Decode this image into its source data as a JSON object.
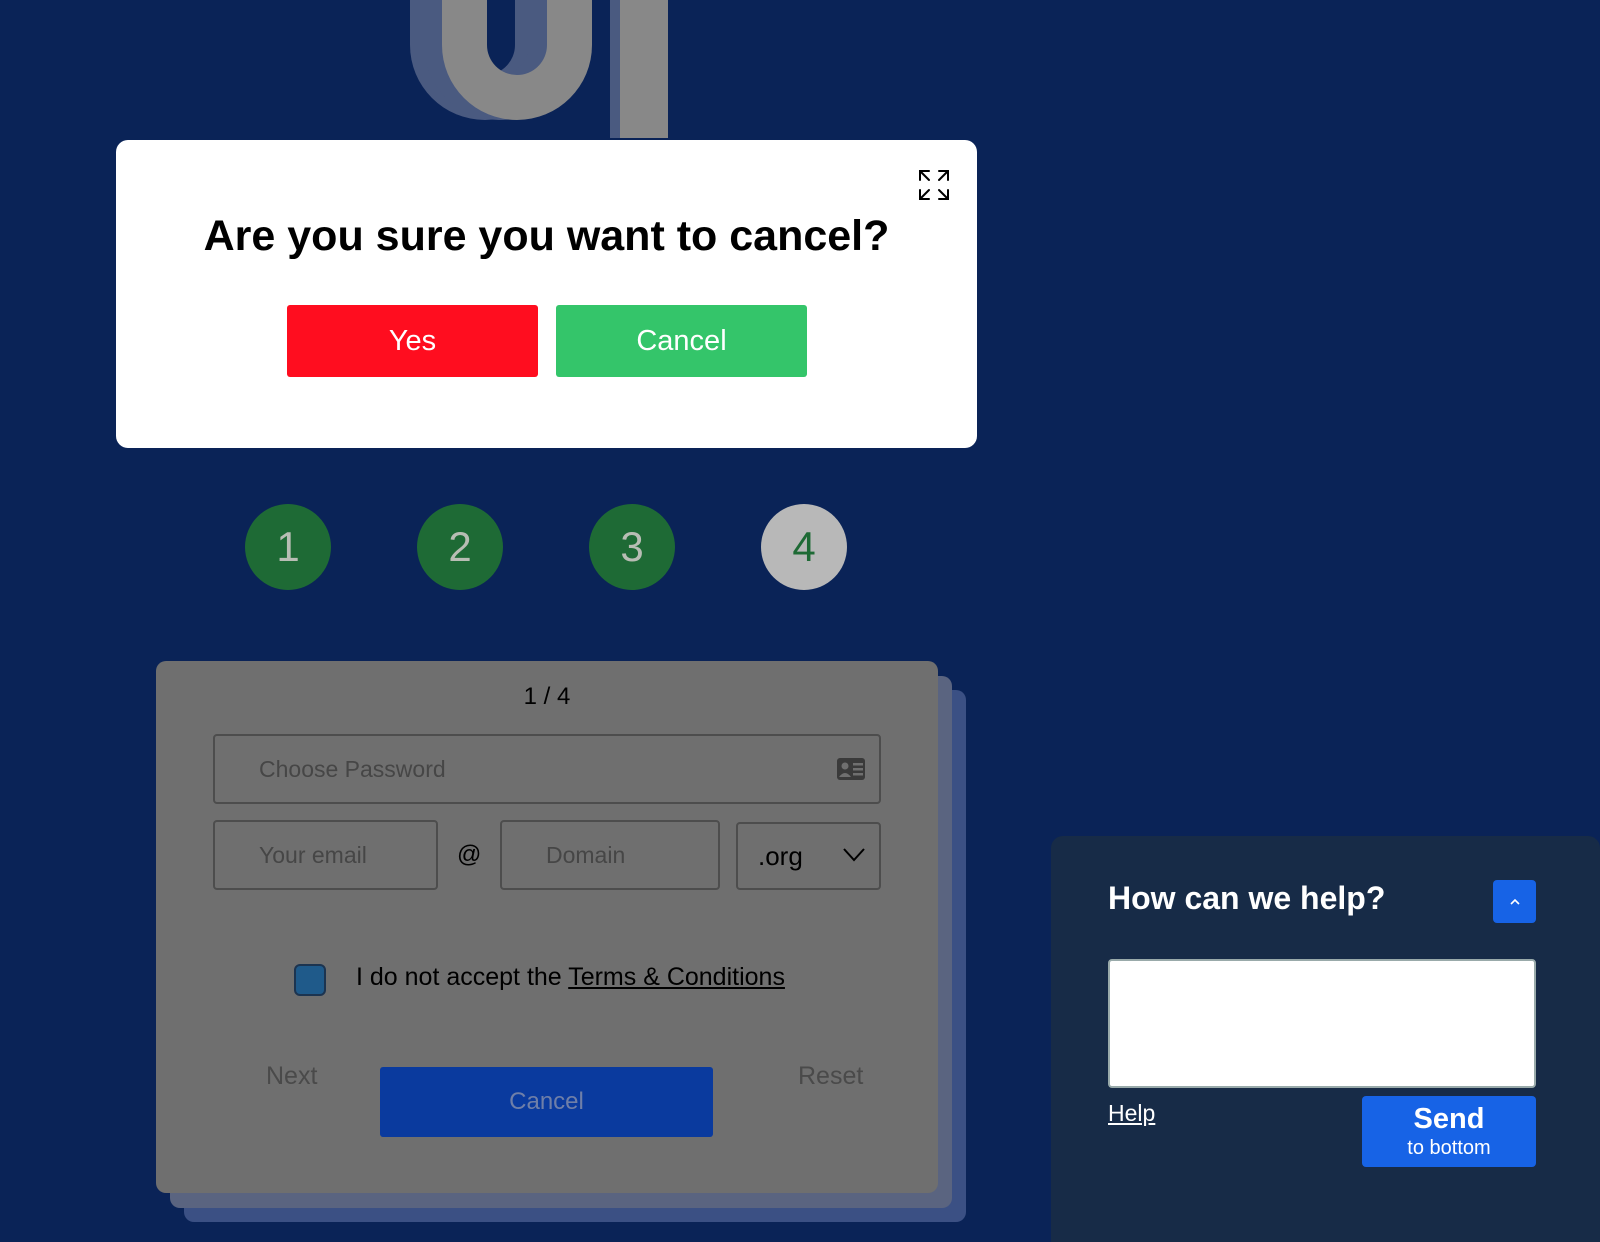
{
  "modal": {
    "title": "Are you sure you want to cancel?",
    "yes_label": "Yes",
    "cancel_label": "Cancel"
  },
  "steps": [
    {
      "label": "1",
      "state": "done"
    },
    {
      "label": "2",
      "state": "done"
    },
    {
      "label": "3",
      "state": "done"
    },
    {
      "label": "4",
      "state": "current"
    }
  ],
  "form": {
    "page_indicator": "1 / 4",
    "password_placeholder": "Choose Password",
    "email_placeholder": "Your email",
    "at_symbol": "@",
    "domain_placeholder": "Domain",
    "tld_selected": ".org",
    "terms_prefix": "I do not accept the ",
    "terms_link": "Terms & Conditions",
    "next_label": "Next",
    "cancel_label": "Cancel",
    "reset_label": "Reset"
  },
  "help": {
    "title": "How can we help?",
    "help_link": "Help",
    "send_label": "Send",
    "send_sublabel": "to bottom"
  },
  "colors": {
    "background": "#0a2357",
    "yes": "#ff0d1f",
    "cancel_modal": "#34c56a",
    "step_done": "#1e6a35",
    "send": "#1763e6"
  }
}
